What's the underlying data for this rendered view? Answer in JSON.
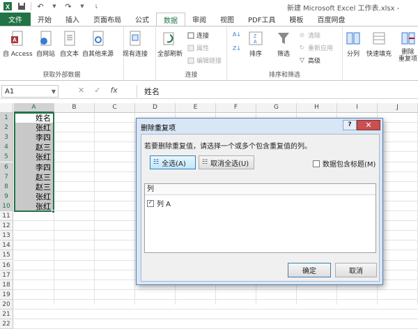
{
  "window": {
    "title": "新建 Microsoft Excel 工作表.xlsx -"
  },
  "tabs": [
    "文件",
    "开始",
    "插入",
    "页面布局",
    "公式",
    "数据",
    "审阅",
    "视图",
    "PDF工具",
    "模板",
    "百度网盘"
  ],
  "active_tab": "数据",
  "ribbon": {
    "external": {
      "label": "获取外部数据",
      "buttons": [
        "自 Access",
        "自网站",
        "自文本",
        "自其他来源"
      ]
    },
    "existing": "现有连接",
    "connections": {
      "label": "连接",
      "refresh": "全部刷新",
      "items": [
        "连接",
        "属性",
        "编辑链接"
      ]
    },
    "sort_filter": {
      "label": "排序和筛选",
      "sort": "排序",
      "filter": "筛选",
      "items": [
        "清除",
        "重新应用",
        "高级"
      ]
    },
    "tools": {
      "split": "分列",
      "flash_fill": "快速填充",
      "remove_dup": "删除\n重复项"
    }
  },
  "formula_bar": {
    "name_box": "A1",
    "fx": "fx",
    "value": "姓名"
  },
  "sheet": {
    "columns": [
      "A",
      "B",
      "C",
      "D",
      "E",
      "F",
      "G",
      "H",
      "I",
      "J"
    ],
    "rows": [
      "1",
      "2",
      "3",
      "4",
      "5",
      "6",
      "7",
      "8",
      "9",
      "10",
      "11",
      "12",
      "13",
      "14",
      "15",
      "16",
      "17",
      "18",
      "19",
      "20",
      "21",
      "22"
    ],
    "col_a_values": [
      "姓名",
      "张红",
      "李四",
      "赵三",
      "张红",
      "李四",
      "赵三",
      "赵三",
      "张红",
      "张红"
    ]
  },
  "dialog": {
    "title": "删除重复项",
    "help": "?",
    "close": "✕",
    "instruction": "若要删除重复值，请选择一个或多个包含重复值的列。",
    "select_all": "全选(A)",
    "unselect_all": "取消全选(U)",
    "has_headers": "数据包含标题(M)",
    "list_header": "列",
    "columns": [
      {
        "label": "列 A",
        "checked": true
      }
    ],
    "ok": "确定",
    "cancel": "取消"
  }
}
